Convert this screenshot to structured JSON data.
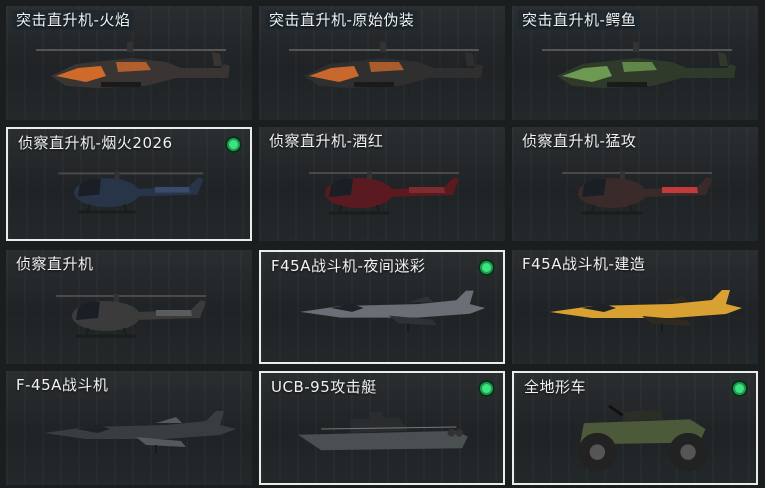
{
  "vehicles": [
    {
      "label": "突击直升机-火焰",
      "owned": false,
      "selected": false,
      "kind": "attack-heli",
      "colors": {
        "body": "#3a3532",
        "accent": "#d06a2a"
      }
    },
    {
      "label": "突击直升机-原始伪装",
      "owned": false,
      "selected": false,
      "kind": "attack-heli",
      "colors": {
        "body": "#2f2f2f",
        "accent": "#c9682d"
      }
    },
    {
      "label": "突击直升机-鳄鱼",
      "owned": false,
      "selected": false,
      "kind": "attack-heli",
      "colors": {
        "body": "#2f3a2a",
        "accent": "#6d9a52"
      }
    },
    {
      "label": "侦察直升机-烟火2026",
      "owned": true,
      "selected": true,
      "kind": "scout-heli",
      "colors": {
        "body": "#283447",
        "accent": "#3a4b6a"
      }
    },
    {
      "label": "侦察直升机-酒红",
      "owned": false,
      "selected": false,
      "kind": "scout-heli",
      "colors": {
        "body": "#5a1a20",
        "accent": "#7d2a30"
      }
    },
    {
      "label": "侦察直升机-猛攻",
      "owned": false,
      "selected": false,
      "kind": "scout-heli",
      "colors": {
        "body": "#3a2a2a",
        "accent": "#c23a3a"
      }
    },
    {
      "label": "侦察直升机",
      "owned": false,
      "selected": false,
      "kind": "scout-heli",
      "colors": {
        "body": "#3a3b3a",
        "accent": "#5a5b5a"
      }
    },
    {
      "label": "F45A战斗机-夜间迷彩",
      "owned": true,
      "selected": true,
      "kind": "jet",
      "colors": {
        "body": "#6a6f75",
        "accent": "#2e3136"
      }
    },
    {
      "label": "F45A战斗机-建造",
      "owned": false,
      "selected": false,
      "kind": "jet",
      "colors": {
        "body": "#d9a032",
        "accent": "#2e2a20"
      }
    },
    {
      "label": "F-45A战斗机",
      "owned": false,
      "selected": false,
      "kind": "jet",
      "colors": {
        "body": "#3a3d40",
        "accent": "#55595c"
      }
    },
    {
      "label": "UCB-95攻击艇",
      "owned": true,
      "selected": true,
      "kind": "boat",
      "colors": {
        "body": "#4a4f52",
        "accent": "#2a2d2f"
      }
    },
    {
      "label": "全地形车",
      "owned": true,
      "selected": true,
      "kind": "atv",
      "colors": {
        "body": "#4c5a3a",
        "accent": "#222"
      }
    }
  ],
  "accent_colors": {
    "owned": "#3ee27e",
    "selected_border": "#e8ecea"
  }
}
